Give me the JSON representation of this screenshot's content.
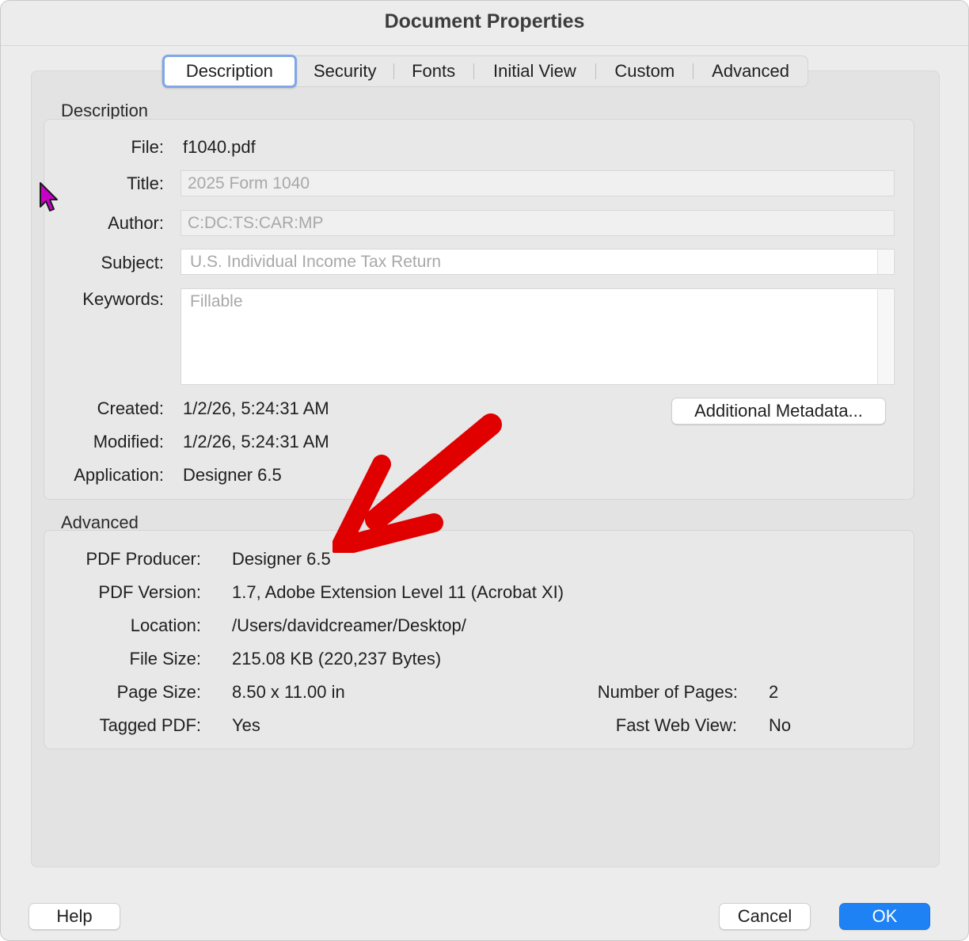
{
  "window": {
    "title": "Document Properties"
  },
  "tabs": [
    {
      "label": "Description",
      "selected": true
    },
    {
      "label": "Security",
      "selected": false
    },
    {
      "label": "Fonts",
      "selected": false
    },
    {
      "label": "Initial View",
      "selected": false
    },
    {
      "label": "Custom",
      "selected": false
    },
    {
      "label": "Advanced",
      "selected": false
    }
  ],
  "description": {
    "section_label": "Description",
    "file_label": "File:",
    "file_value": "f1040.pdf",
    "title_label": "Title:",
    "title_value": "2025 Form 1040",
    "author_label": "Author:",
    "author_value": "C:DC:TS:CAR:MP",
    "subject_label": "Subject:",
    "subject_value": "U.S. Individual Income Tax Return",
    "keywords_label": "Keywords:",
    "keywords_value": "Fillable",
    "created_label": "Created:",
    "created_value": "1/2/26, 5:24:31 AM",
    "modified_label": "Modified:",
    "modified_value": "1/2/26, 5:24:31 AM",
    "application_label": "Application:",
    "application_value": "Designer 6.5",
    "additional_metadata_button": "Additional Metadata..."
  },
  "advanced": {
    "section_label": "Advanced",
    "pdf_producer_label": "PDF Producer:",
    "pdf_producer_value": "Designer 6.5",
    "pdf_version_label": "PDF Version:",
    "pdf_version_value": "1.7, Adobe Extension Level 11 (Acrobat XI)",
    "location_label": "Location:",
    "location_value": "/Users/davidcreamer/Desktop/",
    "file_size_label": "File Size:",
    "file_size_value": "215.08 KB (220,237 Bytes)",
    "page_size_label": "Page Size:",
    "page_size_value": "8.50 x 11.00 in",
    "num_pages_label": "Number of Pages:",
    "num_pages_value": "2",
    "tagged_pdf_label": "Tagged PDF:",
    "tagged_pdf_value": "Yes",
    "fast_web_view_label": "Fast Web View:",
    "fast_web_view_value": "No"
  },
  "footer": {
    "help_button": "Help",
    "cancel_button": "Cancel",
    "ok_button": "OK"
  },
  "colors": {
    "accent": "#1e82f5",
    "tab_focus_ring": "#7fa7e6",
    "annotation_arrow": "#e00000",
    "cursor": "#c800c8"
  },
  "icons": [
    "mouse-pointer-icon",
    "annotation-arrow-icon"
  ]
}
